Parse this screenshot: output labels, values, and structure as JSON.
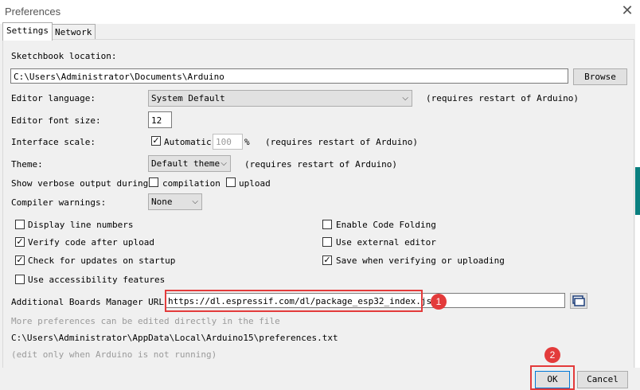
{
  "window": {
    "title": "Preferences"
  },
  "tabs": [
    "Settings",
    "Network"
  ],
  "sketchbook": {
    "label": "Sketchbook location:",
    "value": "C:\\Users\\Administrator\\Documents\\Arduino",
    "browse": "Browse"
  },
  "editor_language": {
    "label": "Editor language:",
    "value": "System Default",
    "note": "(requires restart of Arduino)"
  },
  "font_size": {
    "label": "Editor font size:",
    "value": "12"
  },
  "interface_scale": {
    "label": "Interface scale:",
    "automatic_label": "Automatic",
    "automatic_checked": true,
    "value": "100",
    "unit": "%",
    "note": "(requires restart of Arduino)"
  },
  "theme": {
    "label": "Theme:",
    "value": "Default theme",
    "note": "(requires restart of Arduino)"
  },
  "verbose": {
    "label": "Show verbose output during:",
    "compilation": "compilation",
    "upload": "upload"
  },
  "compiler_warnings": {
    "label": "Compiler warnings:",
    "value": "None"
  },
  "options_left": [
    {
      "label": "Display line numbers",
      "checked": false
    },
    {
      "label": "Verify code after upload",
      "checked": true
    },
    {
      "label": "Check for updates on startup",
      "checked": true
    },
    {
      "label": "Use accessibility features",
      "checked": false
    }
  ],
  "options_right": [
    {
      "label": "Enable Code Folding",
      "checked": false
    },
    {
      "label": "Use external editor",
      "checked": false
    },
    {
      "label": "Save when verifying or uploading",
      "checked": true
    }
  ],
  "boards_urls": {
    "label": "Additional Boards Manager URLs:",
    "value": "https://dl.espressif.com/dl/package_esp32_index.json"
  },
  "more_prefs": {
    "line1": "More preferences can be edited directly in the file",
    "path": "C:\\Users\\Administrator\\AppData\\Local\\Arduino15\\preferences.txt",
    "line3": "(edit only when Arduino is not running)"
  },
  "buttons": {
    "ok": "OK",
    "cancel": "Cancel"
  },
  "annotations": {
    "badge1": "1",
    "badge2": "2"
  },
  "colors": {
    "highlight": "#e33b3b"
  }
}
